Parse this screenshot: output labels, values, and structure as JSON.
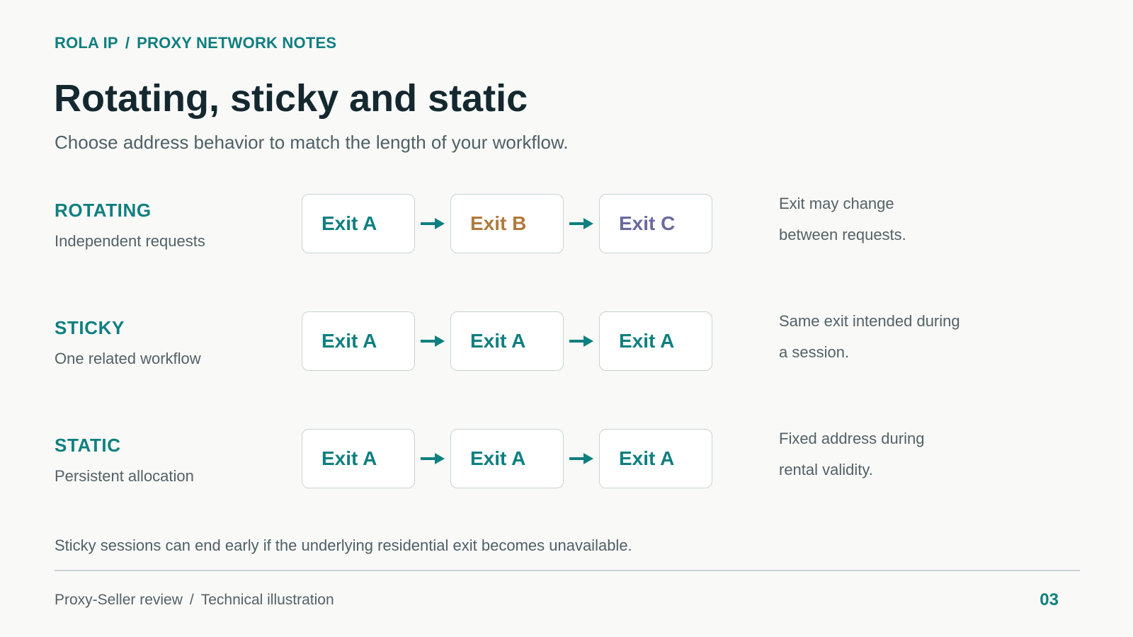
{
  "header": {
    "brand": "ROLA IP",
    "section": "PROXY NETWORK NOTES",
    "separator": "/",
    "title": "Rotating, sticky and static",
    "subtitle": "Choose address behavior to match the length of your workflow."
  },
  "colors": {
    "accent": "#0f7f80",
    "exit_b": "#b07a3c",
    "exit_c": "#6a6a9e",
    "border": "#c8d3d4"
  },
  "rows": [
    {
      "label": "ROTATING",
      "sub": "Independent requests",
      "exits": [
        {
          "text": "Exit A",
          "color": "#0f7f80"
        },
        {
          "text": "Exit B",
          "color": "#b07a3c"
        },
        {
          "text": "Exit C",
          "color": "#6a6a9e"
        }
      ],
      "note_line1": "Exit may change",
      "note_line2": "between requests."
    },
    {
      "label": "STICKY",
      "sub": "One related workflow",
      "exits": [
        {
          "text": "Exit A",
          "color": "#0f7f80"
        },
        {
          "text": "Exit A",
          "color": "#0f7f80"
        },
        {
          "text": "Exit A",
          "color": "#0f7f80"
        }
      ],
      "note_line1": "Same exit intended during",
      "note_line2": "a session."
    },
    {
      "label": "STATIC",
      "sub": "Persistent allocation",
      "exits": [
        {
          "text": "Exit A",
          "color": "#0f7f80"
        },
        {
          "text": "Exit A",
          "color": "#0f7f80"
        },
        {
          "text": "Exit A",
          "color": "#0f7f80"
        }
      ],
      "note_line1": "Fixed address during",
      "note_line2": "rental validity."
    }
  ],
  "footnote": "Sticky sessions can end early if the underlying residential exit becomes unavailable.",
  "footer": {
    "source": "Proxy-Seller review",
    "separator": "/",
    "kind": "Technical illustration",
    "page": "03"
  }
}
